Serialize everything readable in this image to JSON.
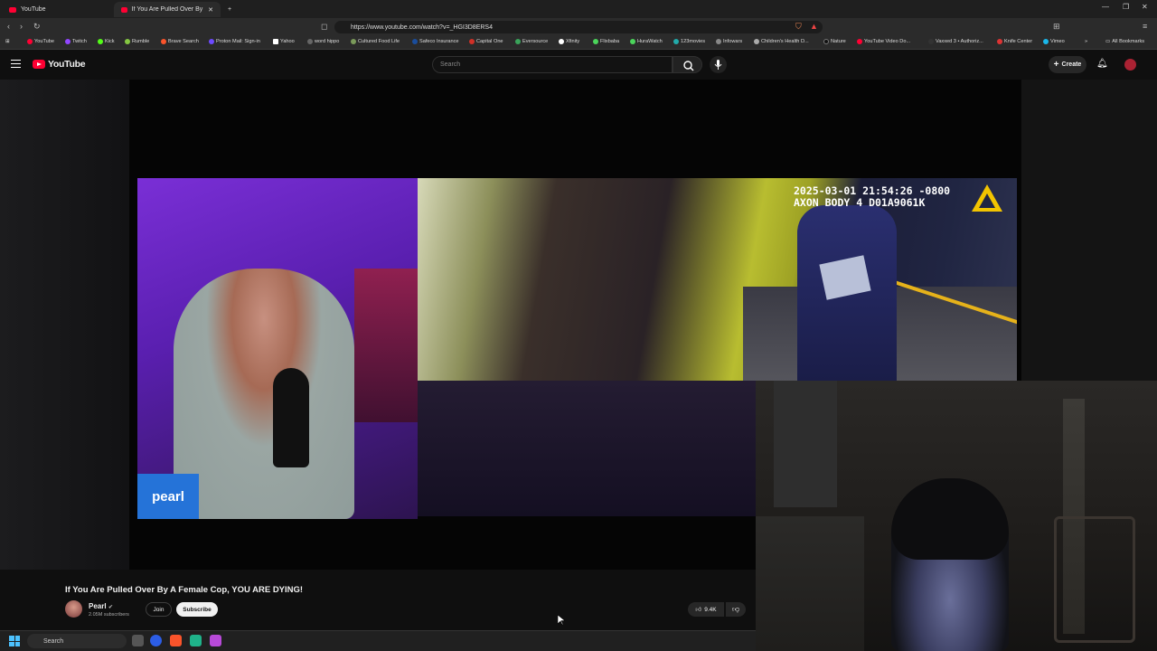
{
  "browser": {
    "tabs": [
      {
        "label": "YouTube",
        "active": false
      },
      {
        "label": "If You Are Pulled Over By A F...",
        "active": true
      }
    ],
    "new_tab": "+",
    "url": "https://www.youtube.com/watch?v=_HGI3D8ERS4",
    "bookmarks": [
      "YouTube",
      "Twitch",
      "Kick",
      "Rumble",
      "Brave Search",
      "Proton Mail: Sign-in",
      "Yahoo",
      "word hippo",
      "Cultured Food Life",
      "Safeco Insurance",
      "Capital One",
      "Eversource",
      "Xfinity",
      "Flixbaba",
      "HuraWatch",
      "123movies",
      "Infowars",
      "Children's Health D...",
      "Nature",
      "YouTube Video Do...",
      "Vaxxed 3 • Authoriz...",
      "Knife Center",
      "Vimeo"
    ],
    "bookmarks_more": "»",
    "all_bookmarks": "All Bookmarks"
  },
  "youtube": {
    "logo_text": "YouTube",
    "search_placeholder": "Search",
    "create_label": "Create",
    "icons": [
      "menu-icon",
      "search-icon",
      "mic-icon",
      "plus-icon",
      "bell-icon"
    ]
  },
  "video": {
    "overlay_badge": "pearl",
    "bodycam_timestamp": "2025-03-01 21:54:26 -0800",
    "bodycam_device": "AXON BODY 4 D01A9061K",
    "title": "If You Are Pulled Over By A Female Cop, YOU ARE DYING!",
    "channel": {
      "name": "Pearl",
      "subscribers": "2.05M subscribers"
    },
    "join_label": "Join",
    "subscribe_label": "Subscribe",
    "likes": "9.4K"
  },
  "taskbar": {
    "search_label": "Search"
  },
  "colors": {
    "youtube_red": "#ff0033",
    "pearl_badge": "#2573d8",
    "bodycam_line": "#e6b21a"
  }
}
